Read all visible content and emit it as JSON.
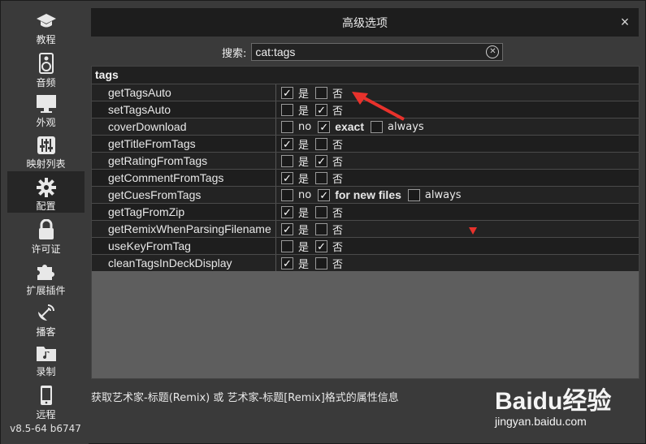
{
  "sidebar": {
    "items": [
      {
        "label": "教程",
        "icon": "graduation-cap-icon",
        "active": false
      },
      {
        "label": "音频",
        "icon": "speaker-icon",
        "active": false
      },
      {
        "label": "外观",
        "icon": "monitor-icon",
        "active": false
      },
      {
        "label": "映射列表",
        "icon": "mixer-sliders-icon",
        "active": false
      },
      {
        "label": "配置",
        "icon": "gear-icon",
        "active": true
      },
      {
        "label": "许可证",
        "icon": "lock-icon",
        "active": false
      },
      {
        "label": "扩展插件",
        "icon": "puzzle-icon",
        "active": false
      },
      {
        "label": "播客",
        "icon": "satellite-dish-icon",
        "active": false
      },
      {
        "label": "录制",
        "icon": "music-folder-icon",
        "active": false
      },
      {
        "label": "远程",
        "icon": "smartphone-icon",
        "active": false
      }
    ],
    "version": "v8.5-64 b6747"
  },
  "dialog": {
    "title": "高级选项",
    "close_label": "×",
    "search_label": "搜索:",
    "search_value": "cat:tags",
    "group": "tags",
    "rows": [
      {
        "name": "getTagsAuto",
        "options": [
          {
            "label": "是",
            "checked": true
          },
          {
            "label": "否",
            "checked": false
          }
        ]
      },
      {
        "name": "setTagsAuto",
        "options": [
          {
            "label": "是",
            "checked": false
          },
          {
            "label": "否",
            "checked": true
          }
        ]
      },
      {
        "name": "coverDownload",
        "options": [
          {
            "label": "no",
            "checked": false
          },
          {
            "label": "exact",
            "checked": true,
            "bold": true
          },
          {
            "label": "always",
            "checked": false
          }
        ]
      },
      {
        "name": "getTitleFromTags",
        "options": [
          {
            "label": "是",
            "checked": true
          },
          {
            "label": "否",
            "checked": false
          }
        ]
      },
      {
        "name": "getRatingFromTags",
        "options": [
          {
            "label": "是",
            "checked": false
          },
          {
            "label": "否",
            "checked": true
          }
        ]
      },
      {
        "name": "getCommentFromTags",
        "options": [
          {
            "label": "是",
            "checked": true
          },
          {
            "label": "否",
            "checked": false
          }
        ]
      },
      {
        "name": "getCuesFromTags",
        "options": [
          {
            "label": "no",
            "checked": false
          },
          {
            "label": "for new files",
            "checked": true,
            "bold": true
          },
          {
            "label": "always",
            "checked": false
          }
        ]
      },
      {
        "name": "getTagFromZip",
        "options": [
          {
            "label": "是",
            "checked": true
          },
          {
            "label": "否",
            "checked": false
          }
        ]
      },
      {
        "name": "getRemixWhenParsingFilename",
        "options": [
          {
            "label": "是",
            "checked": true
          },
          {
            "label": "否",
            "checked": false
          }
        ]
      },
      {
        "name": "useKeyFromTag",
        "options": [
          {
            "label": "是",
            "checked": false
          },
          {
            "label": "否",
            "checked": true
          }
        ]
      },
      {
        "name": "cleanTagsInDeckDisplay",
        "options": [
          {
            "label": "是",
            "checked": true
          },
          {
            "label": "否",
            "checked": false
          }
        ]
      }
    ],
    "description": "获取艺术家-标题(Remix) 或 艺术家-标题[Remix]格式的属性信息"
  },
  "colors": {
    "annotation_red": "#e8322c",
    "accent_dark": "#1d1d1d"
  },
  "watermark": {
    "brand": "Baidu经验",
    "url": "jingyan.baidu.com"
  }
}
